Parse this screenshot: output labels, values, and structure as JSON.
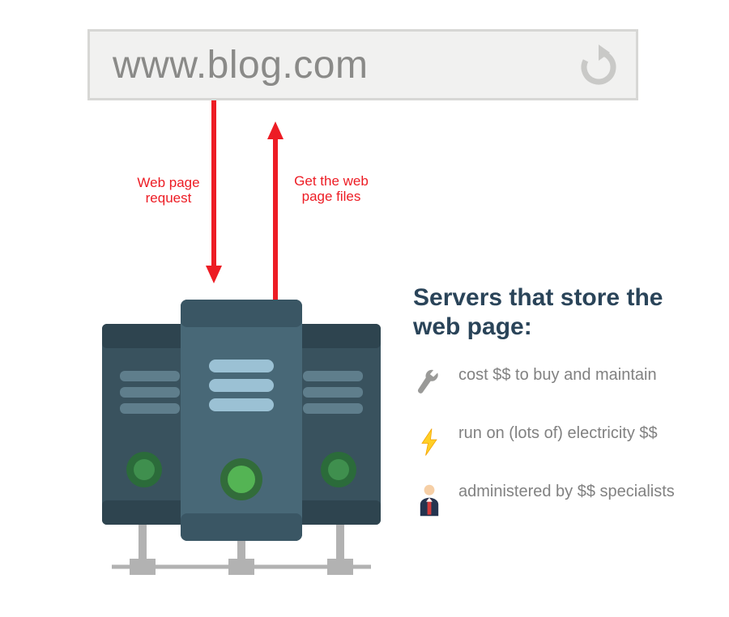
{
  "urlbar": {
    "text": "www.blog.com"
  },
  "arrows": {
    "request_label": "Web page\nrequest",
    "response_label": "Get the web\npage files"
  },
  "info": {
    "title": "Servers that store the web page:",
    "items": [
      {
        "icon": "wrench-icon",
        "text": "cost $$ to buy and maintain"
      },
      {
        "icon": "lightning-icon",
        "text": "run on (lots of) electricity $$"
      },
      {
        "icon": "person-icon",
        "text": "administered by $$ specialists"
      }
    ]
  },
  "colors": {
    "accent_red": "#ed1c24",
    "heading": "#2a4459",
    "body_grey": "#818181"
  }
}
